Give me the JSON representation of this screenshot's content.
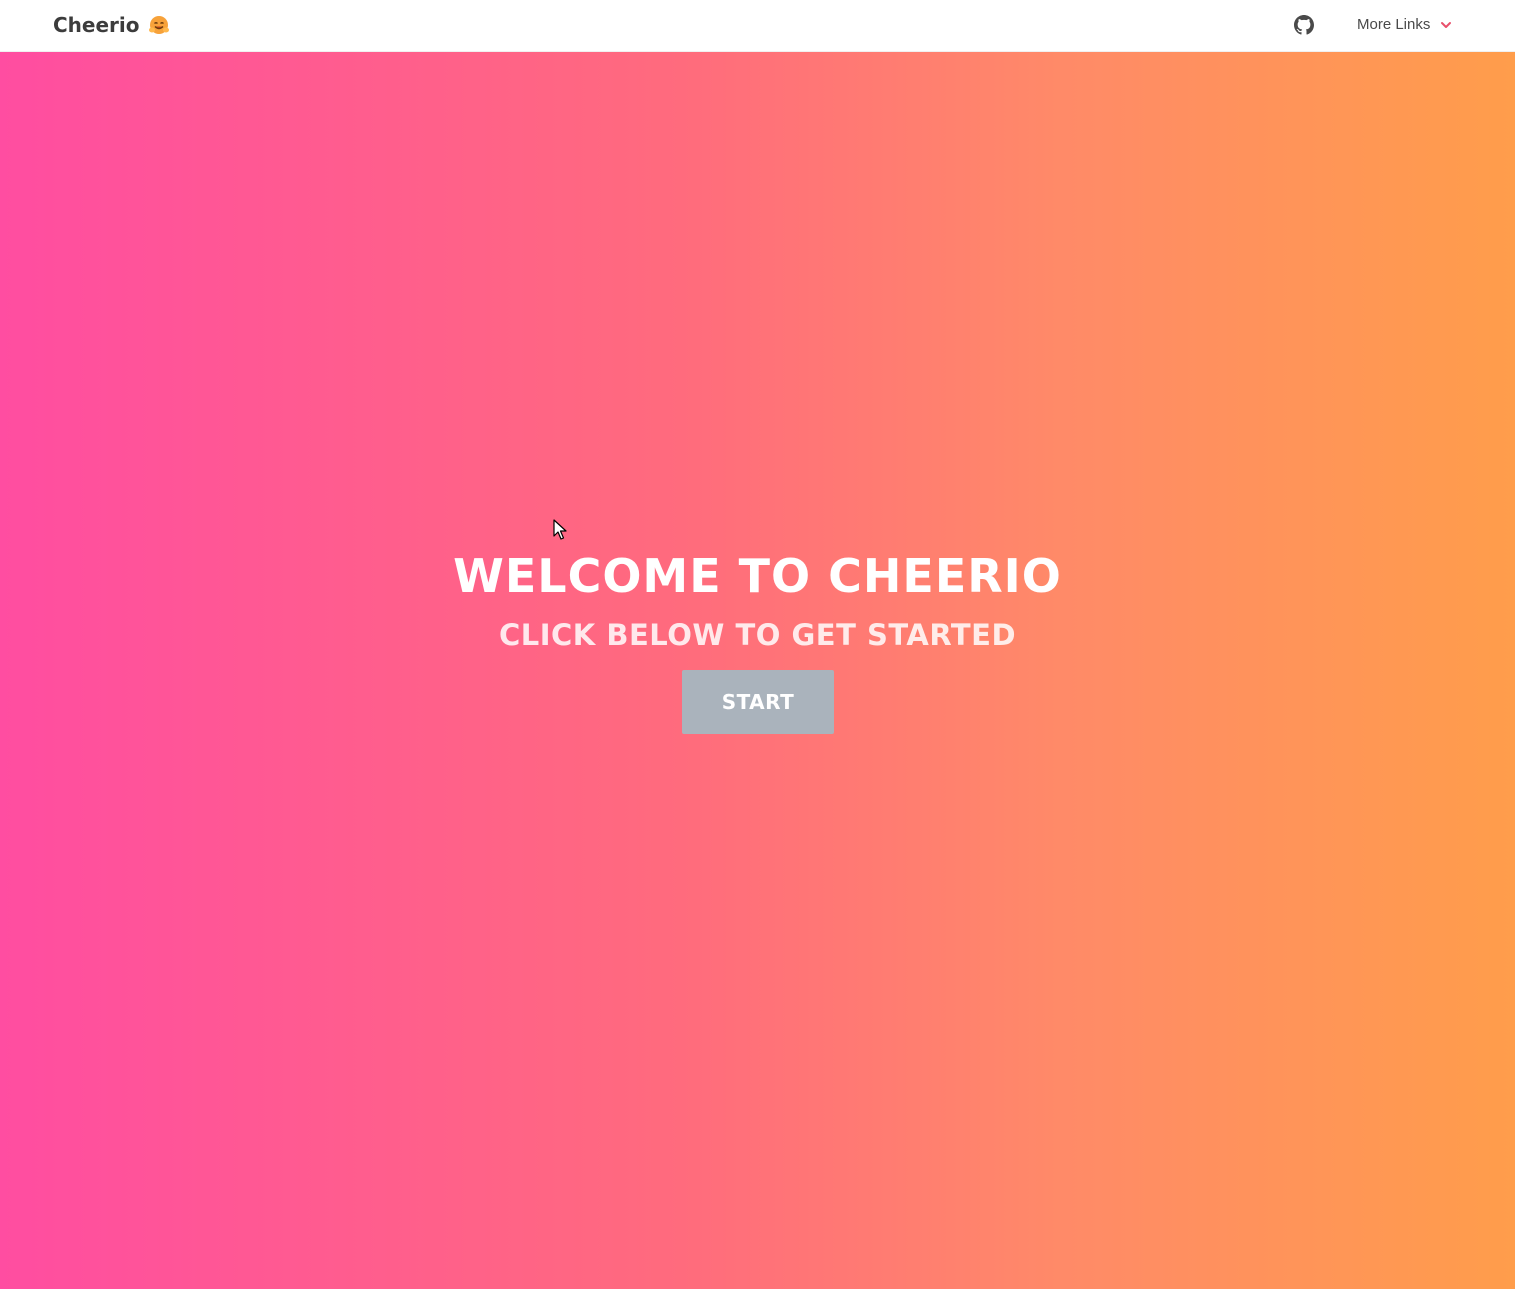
{
  "nav": {
    "brand": "Cheerio",
    "brand_emoji_icon": "hugging-face-emoji-icon",
    "github_icon": "github-icon",
    "more_links": "More Links",
    "chevron_icon": "chevron-down-icon",
    "accent_color": "#e8506b"
  },
  "hero": {
    "title": "WELCOME TO CHEERIO",
    "subtitle": "CLICK BELOW TO GET STARTED",
    "start_button": "START",
    "gradient": [
      "#ff4da1",
      "#ff6b7d",
      "#ff8a68",
      "#ff9d4b"
    ],
    "button_color": "#aab3bc"
  }
}
